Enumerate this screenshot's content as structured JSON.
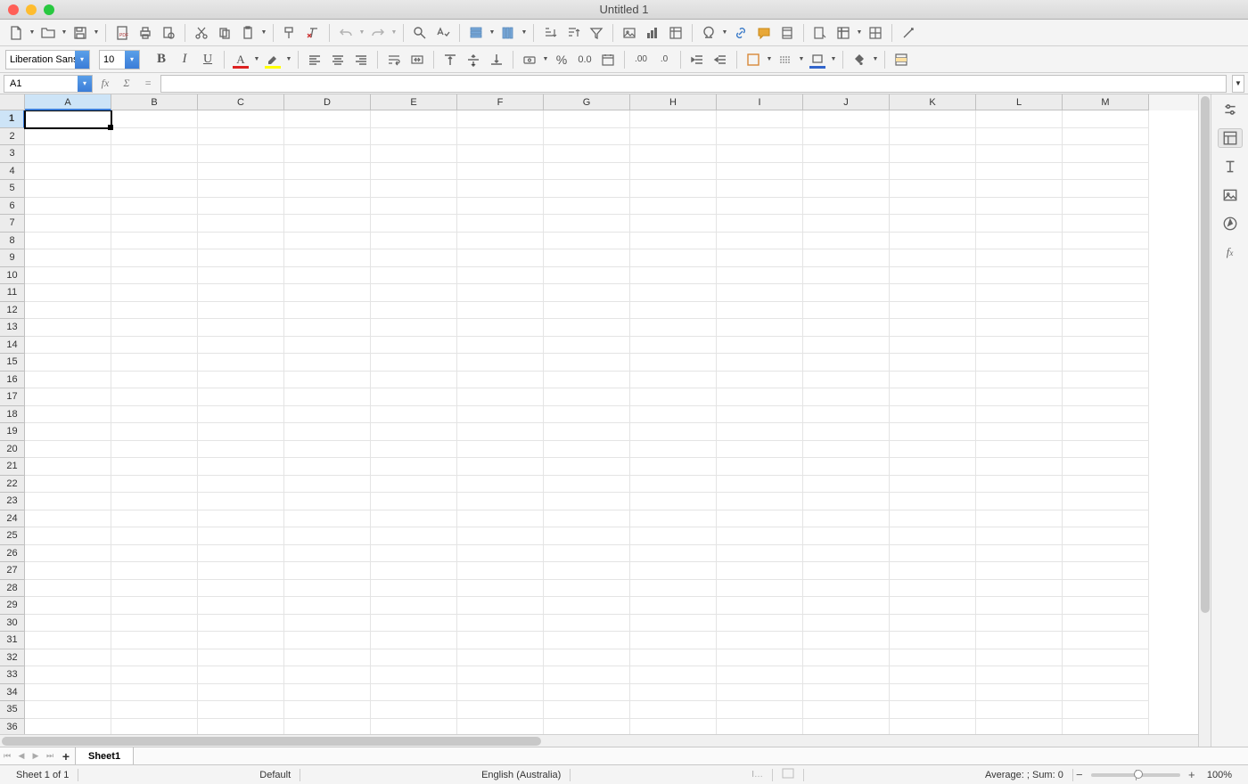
{
  "window": {
    "title": "Untitled 1"
  },
  "format": {
    "font_name": "Liberation Sans",
    "font_size": "10"
  },
  "namebox": {
    "ref": "A1"
  },
  "fx_buttons": {
    "fx": "fx",
    "sigma": "Σ",
    "eq": "="
  },
  "columns": [
    "A",
    "B",
    "C",
    "D",
    "E",
    "F",
    "G",
    "H",
    "I",
    "J",
    "K",
    "L",
    "M"
  ],
  "rows": [
    "1",
    "2",
    "3",
    "4",
    "5",
    "6",
    "7",
    "8",
    "9",
    "10",
    "11",
    "12",
    "13",
    "14",
    "15",
    "16",
    "17",
    "18",
    "19",
    "20",
    "21",
    "22",
    "23",
    "24",
    "25",
    "26",
    "27",
    "28",
    "29",
    "30",
    "31",
    "32",
    "33",
    "34",
    "35",
    "36"
  ],
  "active_cell": {
    "col": 0,
    "row": 0
  },
  "sheet_tabs": {
    "active": "Sheet1"
  },
  "statusbar": {
    "sheet_info": "Sheet 1 of 1",
    "style": "Default",
    "locale": "English (Australia)",
    "stats": "Average: ; Sum: 0",
    "zoom": "100%"
  }
}
